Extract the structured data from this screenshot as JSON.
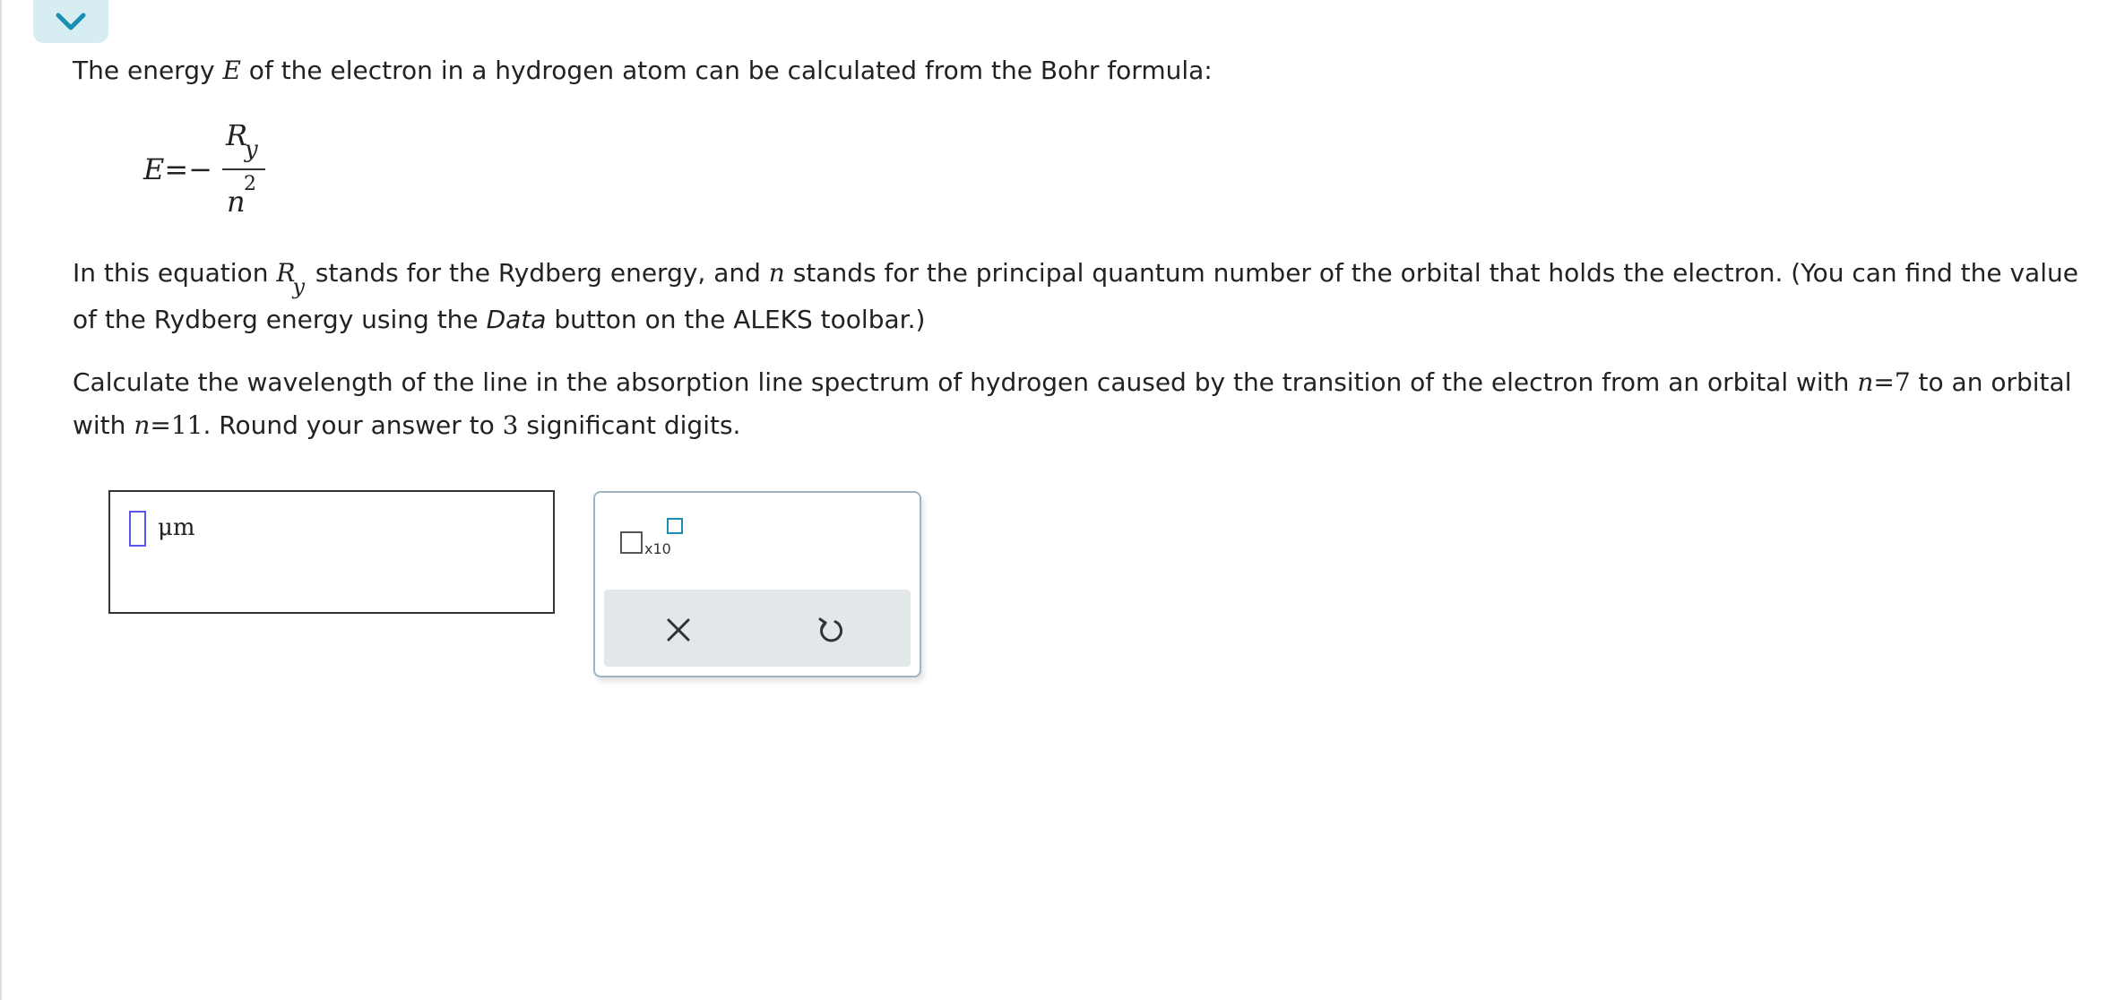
{
  "toolbar": {
    "collapse_icon": "chevron-down-icon",
    "accent_color": "#1a8fb3"
  },
  "problem": {
    "intro": {
      "before": "The energy ",
      "var_e": "E",
      "after": " of the electron in a hydrogen atom can be calculated from the Bohr formula:"
    },
    "formula": {
      "lhs": "E=−",
      "numerator": "R",
      "numerator_sub": "y",
      "denominator": "n",
      "denominator_sup": "2"
    },
    "explanation": {
      "line1_before": "In this equation ",
      "var_r": "R",
      "var_r_sub": "y",
      "line1_mid": " stands for the Rydberg energy, and ",
      "var_n": "n",
      "line1_after": " stands for the principal quantum number of the orbital that holds the electron. (You can find the value",
      "line2_before": "of the Rydberg energy using the ",
      "line2_emph": "Data",
      "line2_after": " button on the ALEKS toolbar.)"
    },
    "question": {
      "line1_before": "Calculate the wavelength of the line in the absorption line spectrum of hydrogen caused by the transition of the electron from an orbital with ",
      "n_from": "n=7",
      "line1_after": " to an orbital",
      "line2_before": "with ",
      "n_to": "n=11",
      "line2_mid": ". Round your answer to ",
      "sig_figs": "3",
      "line2_after": " significant digits."
    }
  },
  "answer": {
    "value": "",
    "unit": "μm"
  },
  "palette": {
    "sci_notation_label": "x10",
    "sci_notation_icon": "scientific-notation-icon",
    "clear_icon": "close-icon",
    "undo_icon": "undo-icon"
  }
}
